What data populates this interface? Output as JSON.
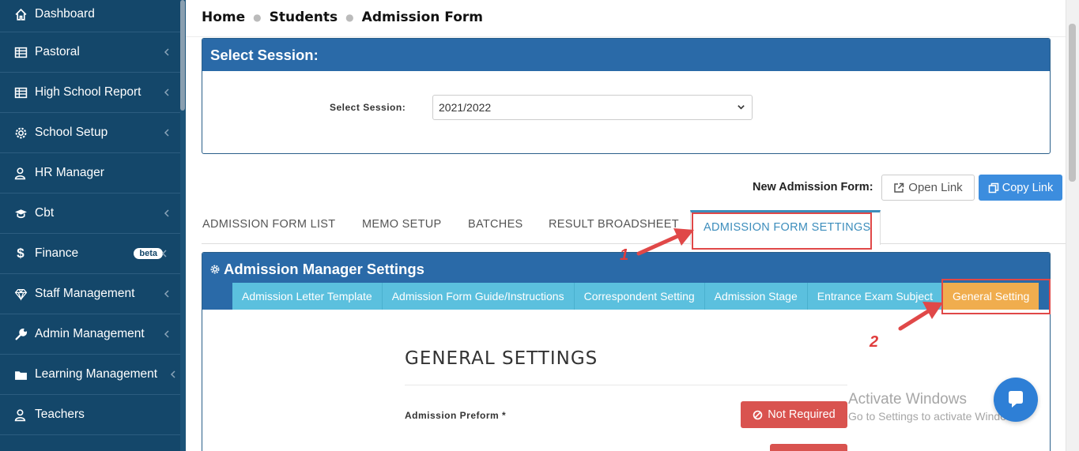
{
  "sidebar": {
    "items": [
      {
        "label": "Dashboard",
        "icon": "home-icon",
        "chevron": false
      },
      {
        "label": "Pastoral",
        "icon": "table-icon",
        "chevron": true
      },
      {
        "label": "High School Report",
        "icon": "table-icon",
        "chevron": true
      },
      {
        "label": "School Setup",
        "icon": "gear-icon",
        "chevron": true
      },
      {
        "label": "HR Manager",
        "icon": "user-icon",
        "chevron": false
      },
      {
        "label": "Cbt",
        "icon": "graduation-cap-icon",
        "chevron": true
      },
      {
        "label": "Finance",
        "icon": "dollar-icon",
        "chevron": true,
        "badge": "beta"
      },
      {
        "label": "Staff Management",
        "icon": "diamond-icon",
        "chevron": true
      },
      {
        "label": "Admin Management",
        "icon": "wrench-icon",
        "chevron": true
      },
      {
        "label": "Learning Management",
        "icon": "folder-icon",
        "chevron": true
      },
      {
        "label": "Teachers",
        "icon": "user-icon",
        "chevron": false
      }
    ]
  },
  "breadcrumb": {
    "home": "Home",
    "students": "Students",
    "current": "Admission Form"
  },
  "session": {
    "panel_title": "Select Session:",
    "label": "Select Session:",
    "selected": "2021/2022"
  },
  "new_form": {
    "label": "New Admission Form:",
    "open_link": "Open Link",
    "copy_link": "Copy Link"
  },
  "tabs": {
    "list": "ADMISSION FORM LIST",
    "memo": "MEMO SETUP",
    "batches": "BATCHES",
    "broadsheet": "RESULT BROADSHEET",
    "settings": "ADMISSION FORM SETTINGS"
  },
  "annotations": {
    "one": "1",
    "two": "2",
    "color": "#e04848"
  },
  "manager": {
    "title": "Admission Manager Settings",
    "subtabs": {
      "letter": "Admission Letter Template",
      "guide": "Admission Form Guide/Instructions",
      "correspondent": "Correspondent Setting",
      "stage": "Admission Stage",
      "exam": "Entrance Exam Subject",
      "general": "General Setting"
    }
  },
  "general": {
    "title": "GENERAL SETTINGS",
    "preform_label": "Admission Preform *",
    "preform_value": "Not Required"
  },
  "watermark": {
    "line1": "Activate Windows",
    "line2": "Go to Settings to activate Windows."
  },
  "colors": {
    "sidebar": "#14476a",
    "panel_header": "#2a6aa8",
    "subtab": "#5bc0de",
    "subtab_active": "#f0ad4e",
    "danger": "#d9534f",
    "primary": "#3c8dde"
  }
}
